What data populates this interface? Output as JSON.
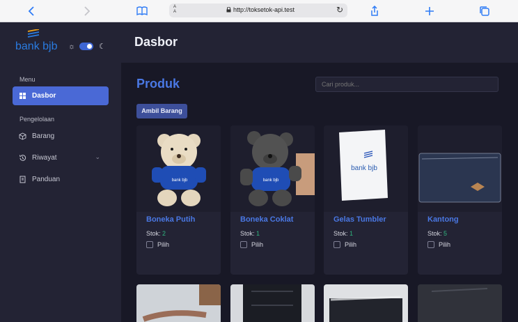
{
  "browser": {
    "url": "http://toksetok-api.test",
    "text_size_label": "A A"
  },
  "sidebar": {
    "brand": "bank bjb",
    "menu_label": "Menu",
    "manage_label": "Pengelolaan",
    "items": [
      {
        "label": "Dasbor",
        "icon": "grid-icon",
        "active": true
      },
      {
        "label": "Barang",
        "icon": "box-icon"
      },
      {
        "label": "Riwayat",
        "icon": "history-icon",
        "has_submenu": true
      },
      {
        "label": "Panduan",
        "icon": "guide-icon"
      }
    ],
    "theme_dark": true
  },
  "main": {
    "page_title": "Dasbor",
    "section_title": "Produk",
    "search_placeholder": "Cari produk...",
    "take_button": "Ambil Barang",
    "stock_label": "Stok:",
    "pick_label": "Pilih",
    "products": [
      {
        "name": "Boneka Putih",
        "stock": "2"
      },
      {
        "name": "Boneka Coklat",
        "stock": "1"
      },
      {
        "name": "Gelas Tumbler",
        "stock": "1"
      },
      {
        "name": "Kantong",
        "stock": "5"
      }
    ]
  },
  "colors": {
    "accent": "#4a69d6",
    "title_blue": "#4a78e4",
    "stock_green": "#2fb57e",
    "background": "#181826",
    "panel": "#232334"
  }
}
